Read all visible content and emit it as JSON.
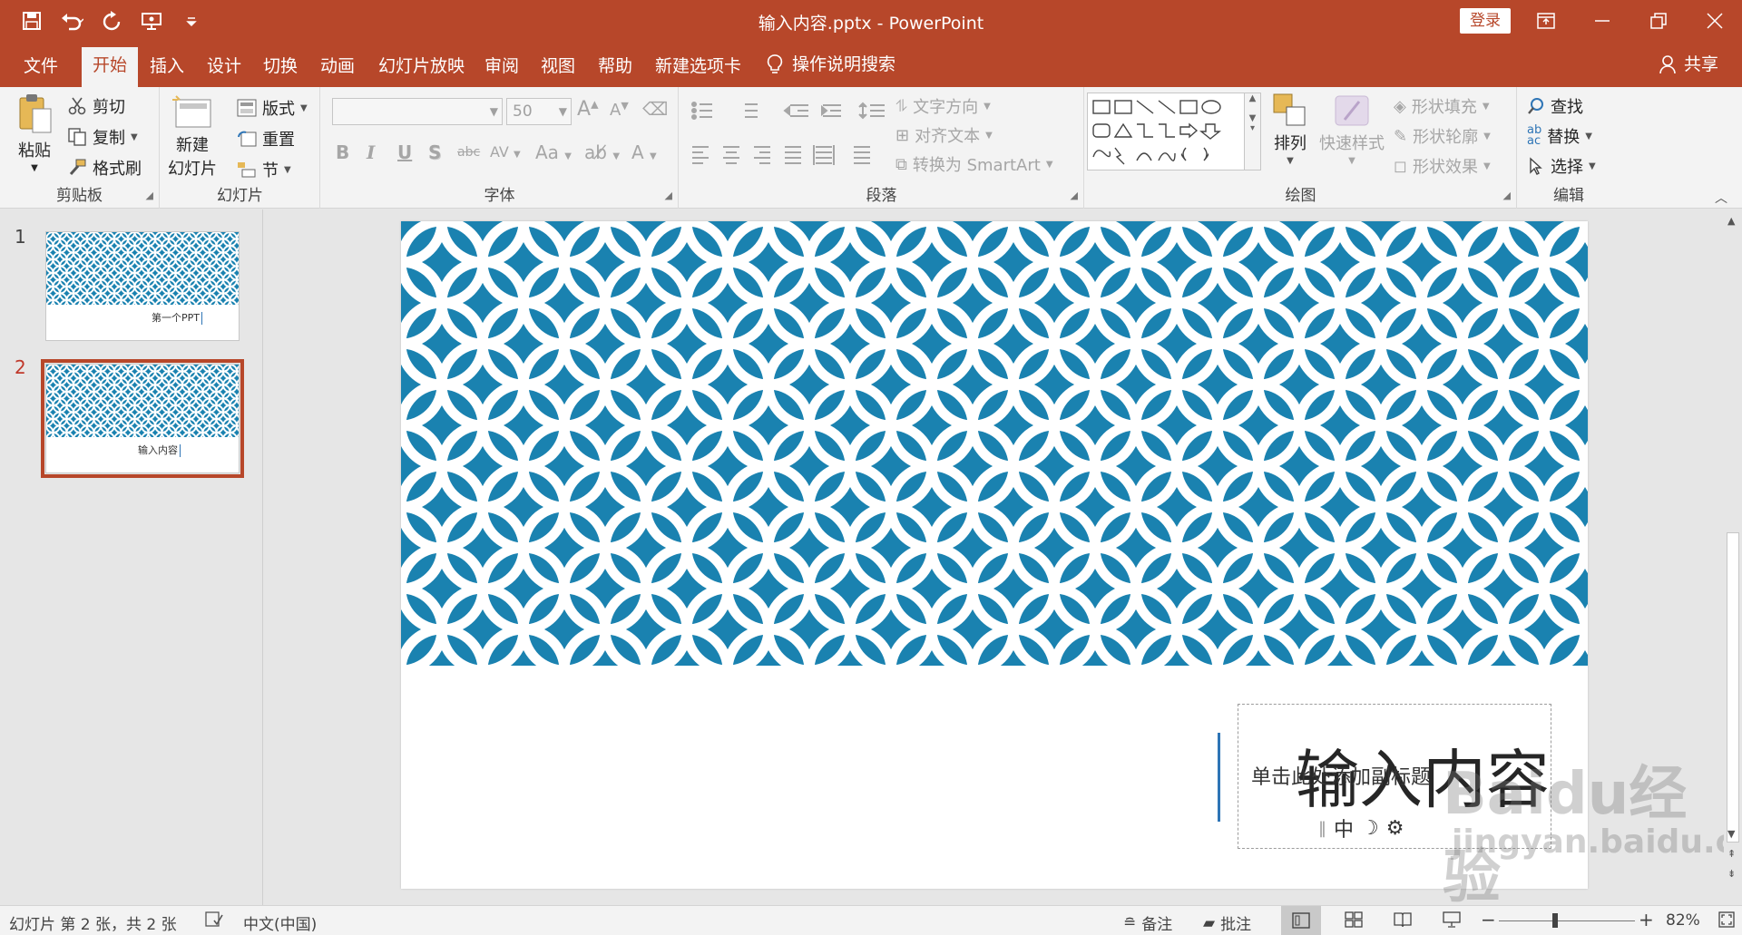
{
  "window": {
    "title": "输入内容.pptx  -  PowerPoint",
    "sign_in": "登录"
  },
  "tabs": [
    "文件",
    "开始",
    "插入",
    "设计",
    "切换",
    "动画",
    "幻灯片放映",
    "审阅",
    "视图",
    "帮助",
    "新建选项卡"
  ],
  "active_tab": "开始",
  "tell_me": "操作说明搜索",
  "share": "共享",
  "ribbon": {
    "clipboard": {
      "label": "剪贴板",
      "paste": "粘贴",
      "cut": "剪切",
      "copy": "复制",
      "format_painter": "格式刷"
    },
    "slides": {
      "label": "幻灯片",
      "new_slide_1": "新建",
      "new_slide_2": "幻灯片",
      "layout": "版式",
      "reset": "重置",
      "section": "节"
    },
    "font": {
      "label": "字体",
      "font_name": "",
      "font_size": "50",
      "bold": "B",
      "italic": "I",
      "underline": "U",
      "shadow": "S",
      "strike": "abc",
      "spacing": "AV",
      "case": "Aa",
      "grow": "A",
      "shrink": "A"
    },
    "paragraph": {
      "label": "段落",
      "text_direction": "文字方向",
      "align_text": "对齐文本",
      "smartart": "转换为 SmartArt"
    },
    "drawing": {
      "label": "绘图",
      "arrange": "排列",
      "quick_styles": "快速样式",
      "shape_fill": "形状填充",
      "shape_outline": "形状轮廓",
      "shape_effects": "形状效果"
    },
    "editing": {
      "label": "编辑",
      "find": "查找",
      "replace": "替换",
      "select": "选择"
    }
  },
  "slides": [
    {
      "number": "1",
      "title": "第一个PPT",
      "selected": false
    },
    {
      "number": "2",
      "title": "输入内容",
      "selected": true
    }
  ],
  "current_slide": {
    "title": "输入内容",
    "subtitle_placeholder": "单击此处添加副标题",
    "ime_text": "中"
  },
  "status": {
    "slide_info": "幻灯片 第 2 张，共 2 张",
    "language": "中文(中国)",
    "notes": "备注",
    "comments": "批注",
    "zoom": "82%"
  },
  "watermark": {
    "line1": "Baidu经验",
    "line2": "jingyan.baidu.com"
  },
  "colors": {
    "accent": "#b7472a",
    "pattern": "#1a82b0",
    "title_line": "#2e75b6"
  }
}
